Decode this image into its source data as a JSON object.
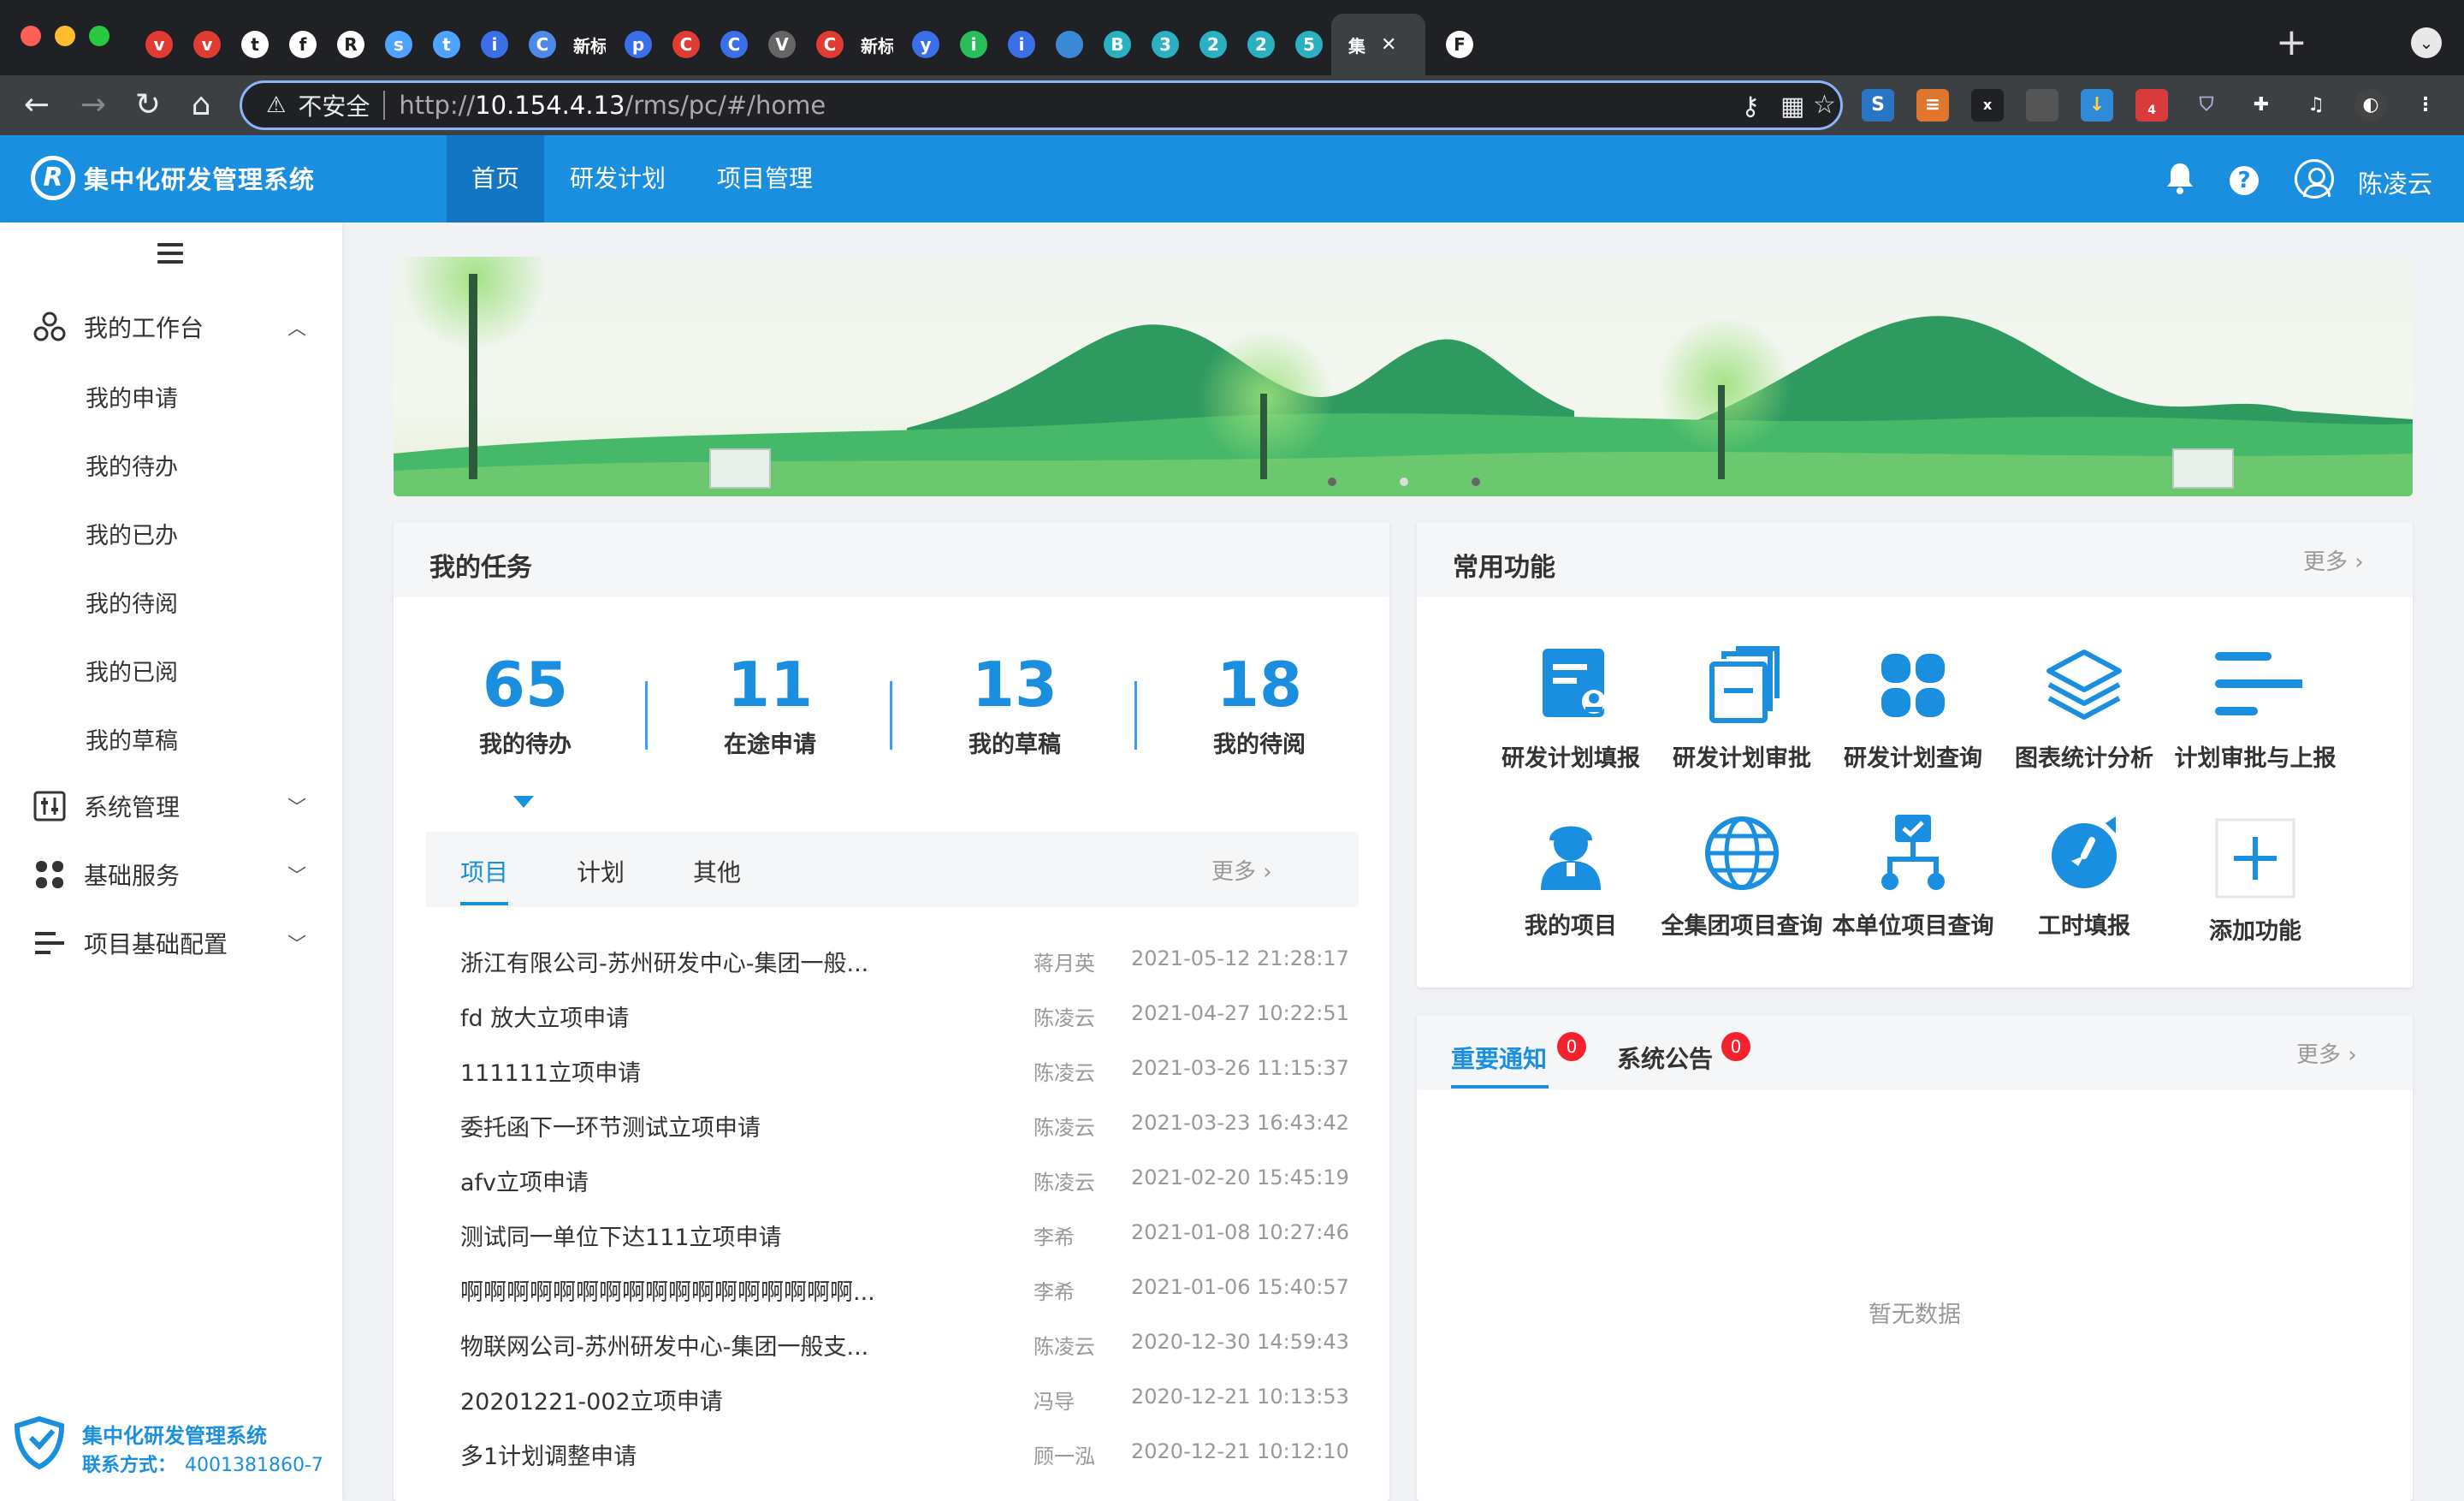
{
  "browser": {
    "tabs": [
      {
        "glyph": "v",
        "color": "#e03c31"
      },
      {
        "glyph": "v",
        "color": "#e03c31"
      },
      {
        "glyph": "t",
        "color": "#ffffff"
      },
      {
        "glyph": "f",
        "color": "#ffffff"
      },
      {
        "glyph": "R",
        "color": "#ffffff"
      },
      {
        "glyph": "s",
        "color": "#4da3ff"
      },
      {
        "glyph": "t",
        "color": "#4da3ff"
      },
      {
        "glyph": "i",
        "color": "#3b6fe8"
      },
      {
        "glyph": "C",
        "color": "#4d8ae8"
      },
      {
        "glyph": "新标",
        "color": "#202124"
      },
      {
        "glyph": "p",
        "color": "#3b6fe8"
      },
      {
        "glyph": "C",
        "color": "#e03c31"
      },
      {
        "glyph": "C",
        "color": "#3b6fe8"
      },
      {
        "glyph": "V",
        "color": "#666666"
      },
      {
        "glyph": "C",
        "color": "#e03c31"
      },
      {
        "glyph": "新标",
        "color": "#202124"
      },
      {
        "glyph": "y",
        "color": "#3b6fe8"
      },
      {
        "glyph": "i",
        "color": "#2bbd5a"
      },
      {
        "glyph": "i",
        "color": "#3b6fe8"
      },
      {
        "glyph": "",
        "color": "#3b8ad8"
      },
      {
        "glyph": "B",
        "color": "#2ab0c0"
      },
      {
        "glyph": "3",
        "color": "#2ab0c0"
      },
      {
        "glyph": "2",
        "color": "#2ab0c0"
      },
      {
        "glyph": "2",
        "color": "#2ab0c0"
      },
      {
        "glyph": "5",
        "color": "#2ab0c0"
      },
      {
        "glyph": "集",
        "color": "#3c4043"
      },
      {
        "glyph": "F",
        "color": "#ffffff"
      }
    ],
    "insecure_label": "不安全",
    "url_prefix": "http://",
    "url_host": "10.154.4.13",
    "url_path": "/rms/pc/#/home",
    "extension_badge": "4"
  },
  "app": {
    "name": "集中化研发管理系统",
    "logo_letter": "R",
    "nav": [
      "首页",
      "研发计划",
      "项目管理"
    ],
    "user": "陈凌云",
    "help_glyph": "?",
    "brand_color": "#1a8fe0"
  },
  "sidebar": {
    "groups": [
      {
        "label": "我的工作台",
        "icon": "workbench-icon",
        "expanded": true,
        "items": [
          "我的申请",
          "我的待办",
          "我的已办",
          "我的待阅",
          "我的已阅",
          "我的草稿"
        ]
      },
      {
        "label": "系统管理",
        "icon": "system-settings-icon",
        "expanded": false
      },
      {
        "label": "基础服务",
        "icon": "grid-icon",
        "expanded": false
      },
      {
        "label": "项目基础配置",
        "icon": "list-config-icon",
        "expanded": false
      }
    ],
    "footer": {
      "title": "集中化研发管理系统",
      "contact_label": "联系方式：",
      "contact_value": "4001381860-7"
    }
  },
  "banner": {
    "slides": 3,
    "active_slide": 0
  },
  "tasks": {
    "title": "我的任务",
    "stats": [
      {
        "value": "65",
        "label": "我的待办"
      },
      {
        "value": "11",
        "label": "在途申请"
      },
      {
        "value": "13",
        "label": "我的草稿"
      },
      {
        "value": "18",
        "label": "我的待阅"
      }
    ],
    "tabs": [
      "项目",
      "计划",
      "其他"
    ],
    "more": "更多",
    "rows": [
      {
        "title": "浙江有限公司-苏州研发中心-集团一般...",
        "person": "蒋月英",
        "time": "2021-05-12 21:28:17"
      },
      {
        "title": "fd 放大立项申请",
        "person": "陈凌云",
        "time": "2021-04-27 10:22:51"
      },
      {
        "title": "111111立项申请",
        "person": "陈凌云",
        "time": "2021-03-26 11:15:37"
      },
      {
        "title": "委托函下一环节测试立项申请",
        "person": "陈凌云",
        "time": "2021-03-23 16:43:42"
      },
      {
        "title": "afv立项申请",
        "person": "陈凌云",
        "time": "2021-02-20 15:45:19"
      },
      {
        "title": "测试同一单位下达111立项申请",
        "person": "李希",
        "time": "2021-01-08 10:27:46"
      },
      {
        "title": "啊啊啊啊啊啊啊啊啊啊啊啊啊啊啊啊啊...",
        "person": "李希",
        "time": "2021-01-06 15:40:57"
      },
      {
        "title": "物联网公司-苏州研发中心-集团一般支...",
        "person": "陈凌云",
        "time": "2020-12-30 14:59:43"
      },
      {
        "title": "20201221-002立项申请",
        "person": "冯导",
        "time": "2020-12-21 10:13:53"
      },
      {
        "title": "多1计划调整申请",
        "person": "顾一泓",
        "time": "2020-12-21 10:12:10"
      }
    ]
  },
  "functions": {
    "title": "常用功能",
    "more": "更多",
    "items": [
      {
        "label": "研发计划填报",
        "icon": "plan-fill-icon"
      },
      {
        "label": "研发计划审批",
        "icon": "plan-approve-icon"
      },
      {
        "label": "研发计划查询",
        "icon": "plan-query-icon"
      },
      {
        "label": "图表统计分析",
        "icon": "layers-icon"
      },
      {
        "label": "计划审批与上报",
        "icon": "report-lines-icon"
      },
      {
        "label": "我的项目",
        "icon": "person-icon"
      },
      {
        "label": "全集团项目查询",
        "icon": "globe-icon"
      },
      {
        "label": "本单位项目查询",
        "icon": "org-tree-icon"
      },
      {
        "label": "工时填报",
        "icon": "clock-icon"
      },
      {
        "label": "添加功能",
        "icon": "plus-icon"
      }
    ]
  },
  "notices": {
    "tabs": [
      {
        "label": "重要通知",
        "count": "0"
      },
      {
        "label": "系统公告",
        "count": "0"
      }
    ],
    "more": "更多",
    "empty": "暂无数据"
  }
}
